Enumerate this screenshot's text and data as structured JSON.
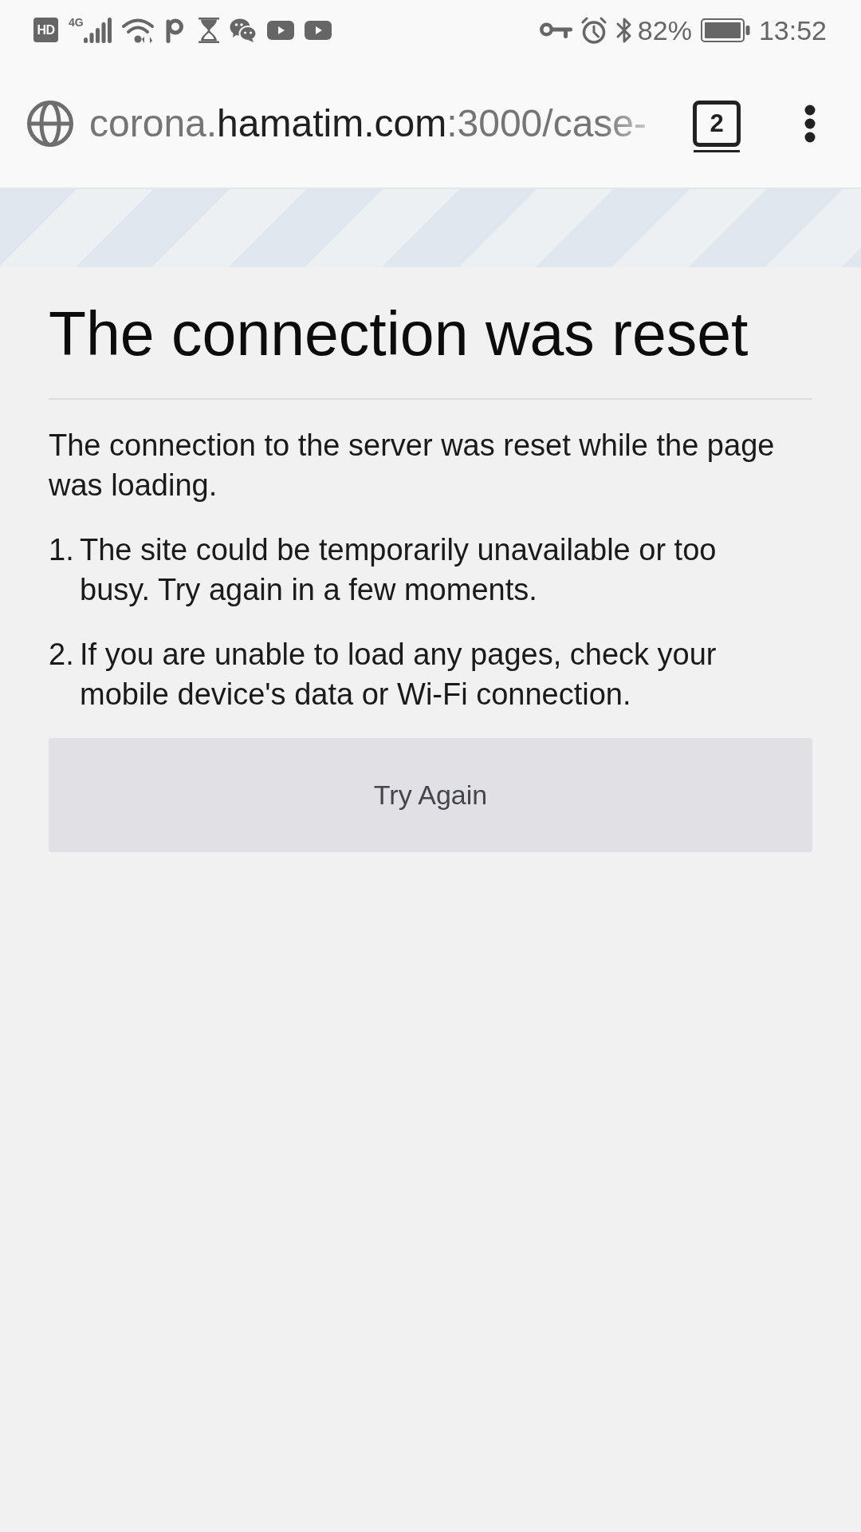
{
  "status_bar": {
    "hd_badge": "HD",
    "network_type": "4G",
    "battery": "82%",
    "time": "13:52"
  },
  "address_bar": {
    "url": {
      "subdomain": "corona.",
      "domain": "hamatim.com",
      "path": ":3000/case-"
    },
    "tab_count": "2"
  },
  "error_page": {
    "title": "The connection was reset",
    "description": "The connection to the server was reset while the page was loading.",
    "suggestions": [
      {
        "number": "1.",
        "text": "The site could be temporarily unavailable or too busy. Try again in a few moments."
      },
      {
        "number": "2.",
        "text": "If you are unable to load any pages, check your mobile device's data or Wi-Fi connection."
      }
    ],
    "button": "Try Again"
  }
}
